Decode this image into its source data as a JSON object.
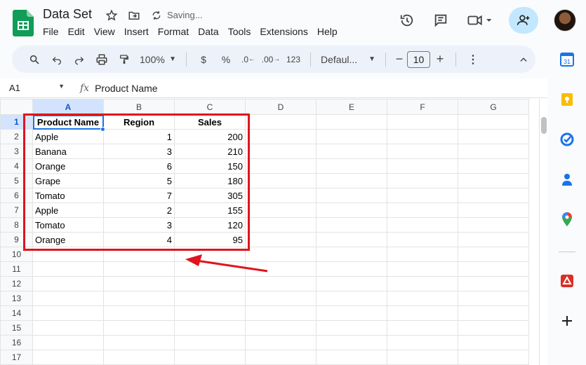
{
  "header": {
    "title": "Data Set",
    "status": "Saving...",
    "menu": [
      "File",
      "Edit",
      "View",
      "Insert",
      "Format",
      "Data",
      "Tools",
      "Extensions",
      "Help"
    ]
  },
  "toolbar": {
    "zoom": "100%",
    "currency": "$",
    "percent": "%",
    "decrease_decimal": ".0",
    "increase_decimal": ".00",
    "number_format": "123",
    "font": "Defaul...",
    "font_size": "10"
  },
  "formula_bar": {
    "cell_ref": "A1",
    "fx": "fx",
    "content": "Product Name"
  },
  "grid": {
    "columns": [
      "A",
      "B",
      "C",
      "D",
      "E",
      "F",
      "G"
    ],
    "row_numbers": [
      "1",
      "2",
      "3",
      "4",
      "5",
      "6",
      "7",
      "8",
      "9",
      "10",
      "11",
      "12",
      "13",
      "14",
      "15",
      "16",
      "17"
    ],
    "rows": [
      [
        "Product Name",
        "Region",
        "Sales"
      ],
      [
        "Apple",
        "1",
        "200"
      ],
      [
        "Banana",
        "3",
        "210"
      ],
      [
        "Orange",
        "6",
        "150"
      ],
      [
        "Grape",
        "5",
        "180"
      ],
      [
        "Tomato",
        "7",
        "305"
      ],
      [
        "Apple",
        "2",
        "155"
      ],
      [
        "Tomato",
        "3",
        "120"
      ],
      [
        "Orange",
        "4",
        "95"
      ]
    ]
  },
  "colors": {
    "accent": "#1a73e8",
    "highlight_box": "#e0141e",
    "share_bg": "#c2e7ff",
    "sheets_green": "#0f9d58"
  },
  "side_icons": [
    "calendar-icon",
    "keep-icon",
    "tasks-icon",
    "contacts-icon",
    "maps-icon",
    "addon-icon",
    "plus-icon"
  ],
  "calendar_day": "31"
}
